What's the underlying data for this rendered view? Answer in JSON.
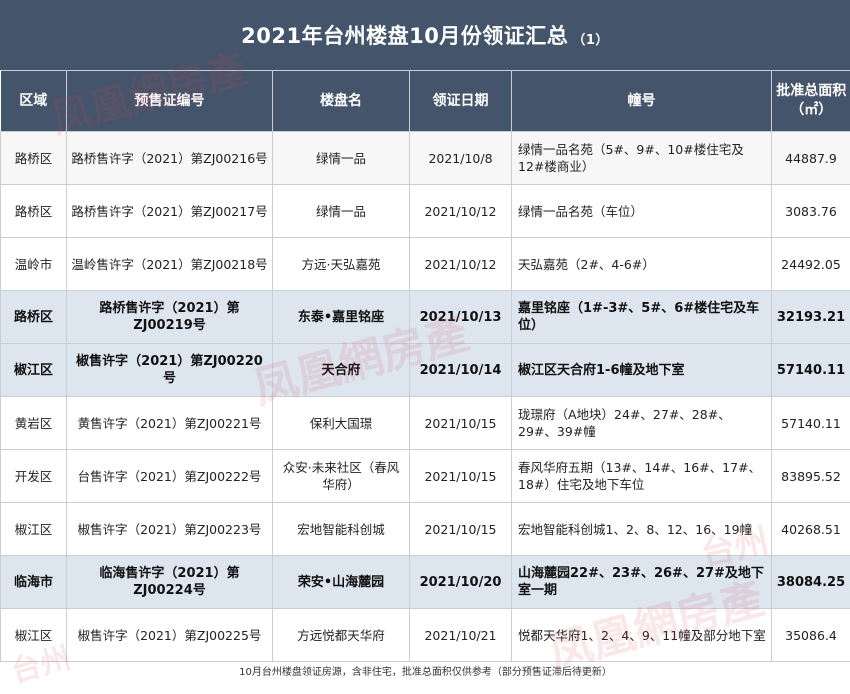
{
  "title": {
    "main": "2021年台州楼盘10月份领证汇总",
    "sub": "（1）"
  },
  "columns": {
    "area": "区域",
    "permit": "预售证编号",
    "project": "楼盘名",
    "date": "领证日期",
    "buildings": "幢号",
    "size": "批准总面积（㎡）"
  },
  "rows": [
    {
      "area": "路桥区",
      "permit": "路桥售许字（2021）第ZJ00216号",
      "project": "绿情一品",
      "date": "2021/10/8",
      "buildings": "绿情一品名苑（5#、9#、10#楼住宅及12#楼商业）",
      "size": "44887.9"
    },
    {
      "area": "路桥区",
      "permit": "路桥售许字（2021）第ZJ00217号",
      "project": "绿情一品",
      "date": "2021/10/12",
      "buildings": "绿情一品名苑（车位）",
      "size": "3083.76"
    },
    {
      "area": "温岭市",
      "permit": "温岭售许字（2021）第ZJ00218号",
      "project": "方远·天弘嘉苑",
      "date": "2021/10/12",
      "buildings": "天弘嘉苑（2#、4-6#）",
      "size": "24492.05"
    },
    {
      "area": "路桥区",
      "permit": "路桥售许字（2021）第ZJ00219号",
      "project": "东泰•嘉里铭座",
      "date": "2021/10/13",
      "buildings": "嘉里铭座（1#-3#、5#、6#楼住宅及车位）",
      "size": "32193.21"
    },
    {
      "area": "椒江区",
      "permit": "椒售许字（2021）第ZJ00220号",
      "project": "天合府",
      "date": "2021/10/14",
      "buildings": "椒江区天合府1-6幢及地下室",
      "size": "57140.11"
    },
    {
      "area": "黄岩区",
      "permit": "黄售许字（2021）第ZJ00221号",
      "project": "保利大国璟",
      "date": "2021/10/15",
      "buildings": "珑璟府（A地块）24#、27#、28#、29#、39#幢",
      "size": "57140.11"
    },
    {
      "area": "开发区",
      "permit": "台售许字（2021）第ZJ00222号",
      "project": "众安·未来社区（春风华府）",
      "date": "2021/10/15",
      "buildings": "春风华府五期（13#、14#、16#、17#、18#）住宅及地下车位",
      "size": "83895.52"
    },
    {
      "area": "椒江区",
      "permit": "椒售许字（2021）第ZJ00223号",
      "project": "宏地智能科创城",
      "date": "2021/10/15",
      "buildings": "宏地智能科创城1、2、8、12、16、19幢",
      "size": "40268.51"
    },
    {
      "area": "临海市",
      "permit": "临海售许字（2021）第ZJ00224号",
      "project": "荣安•山海麓园",
      "date": "2021/10/20",
      "buildings": "山海麓园22#、23#、26#、27#及地下室一期",
      "size": "38084.25"
    },
    {
      "area": "椒江区",
      "permit": "椒售许字（2021）第ZJ00225号",
      "project": "方远悦都天华府",
      "date": "2021/10/21",
      "buildings": "悦都天华府1、2、4、9、11幢及部分地下室",
      "size": "35086.4"
    }
  ],
  "footnote": "10月台州楼盘领证房源，含非住宅，批准总面积仅供参考（部分预售证滞后待更新）",
  "watermark": "凤凰网房产 台州 house.ifeng.com",
  "colors": {
    "header": "#44546a",
    "highlight_row": "#dde5ef"
  }
}
